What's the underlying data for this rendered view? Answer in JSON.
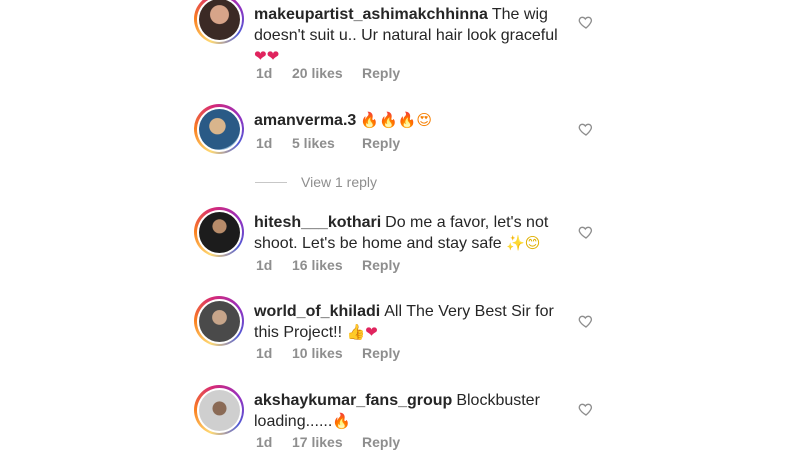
{
  "comments": [
    {
      "username": "makeupartist_ashimakchhinna",
      "text": "The wig doesn't suit u.. Ur natural hair look graceful",
      "emoji": "❤❤",
      "time": "1d",
      "likes": "20 likes",
      "reply": "Reply",
      "avatar_colors": [
        "#3b2a25",
        "#c98f79"
      ]
    },
    {
      "username": "amanverma.3",
      "text": "",
      "emoji": "🔥🔥🔥😍",
      "time": "1d",
      "likes": "5 likes",
      "reply": "Reply",
      "avatar_colors": [
        "#2a5a86",
        "#d9b58c"
      ]
    },
    {
      "username": "hitesh___kothari",
      "text": "Do me a favor, let's not shoot. Let's be home and stay safe",
      "emoji": "✨😊",
      "time": "1d",
      "likes": "16 likes",
      "reply": "Reply",
      "avatar_colors": [
        "#1c1c1c",
        "#b88c6a"
      ]
    },
    {
      "username": "world_of_khiladi",
      "text": "All The Very Best Sir for this Project!!",
      "emoji": "👍❤",
      "time": "1d",
      "likes": "10 likes",
      "reply": "Reply",
      "avatar_colors": [
        "#4a4a4a",
        "#c7a58a"
      ]
    },
    {
      "username": "akshaykumar_fans_group",
      "text": "Blockbuster loading......",
      "emoji": "🔥",
      "time": "1d",
      "likes": "17 likes",
      "reply": "Reply",
      "avatar_colors": [
        "#cfcfcf",
        "#8a6a55"
      ]
    }
  ],
  "view_replies": "View 1 reply",
  "colors": {
    "text": "#262626",
    "muted": "#8e8e8e",
    "heart_red": "#ed4956",
    "fire": "#f77f00"
  },
  "icons": {
    "like": "heart-outline-icon"
  }
}
